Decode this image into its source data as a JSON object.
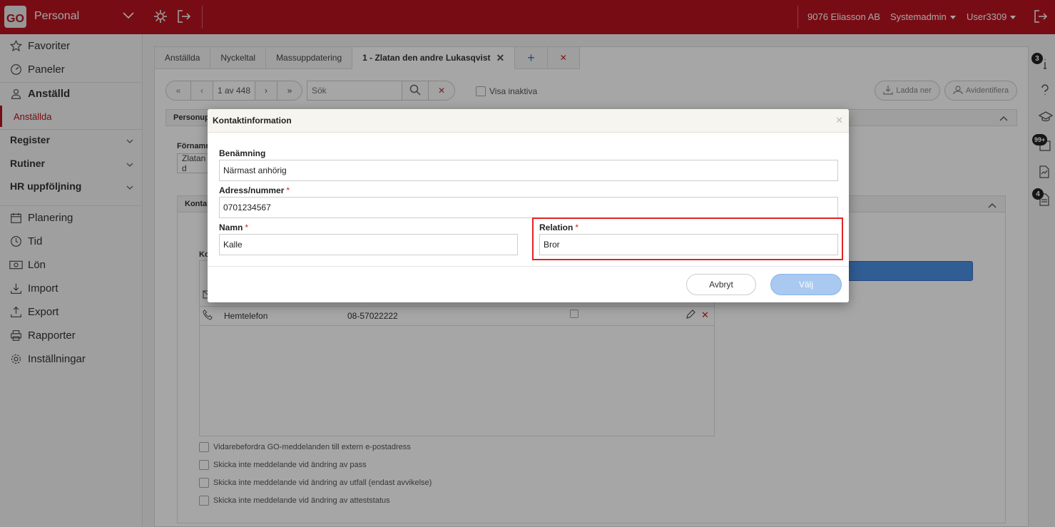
{
  "topbar": {
    "logo": "GO",
    "module": "Personal",
    "company": "9076 Eliasson AB",
    "role": "Systemadmin",
    "user": "User3309",
    "accent": "#b8131f"
  },
  "sidebar": {
    "favorites": "Favoriter",
    "panels": "Paneler",
    "employee": "Anställd",
    "employees_sub": "Anställda",
    "register": "Register",
    "routines": "Rutiner",
    "hr_followup": "HR uppföljning",
    "planning": "Planering",
    "time": "Tid",
    "salary": "Lön",
    "import": "Import",
    "export": "Export",
    "reports": "Rapporter",
    "settings": "Inställningar"
  },
  "tabs": [
    {
      "label": "Anställda"
    },
    {
      "label": "Nyckeltal"
    },
    {
      "label": "Massuppdatering"
    },
    {
      "label": "1 - Zlatan den andre Lukasqvist"
    }
  ],
  "toolbar": {
    "pager": "1 av 448",
    "search_placeholder": "Sök",
    "show_inactive": "Visa inaktiva",
    "download": "Ladda ner",
    "anonymize": "Avidentifiera"
  },
  "background": {
    "section_person": "Personupp",
    "first_name_label": "Förnamn",
    "first_name_value": "Zlatan d",
    "section_contact": "Kontakt",
    "contact_sub": "Ko",
    "row_type": "Hemtelefon",
    "row_value": "08-57022222",
    "checks": [
      "Vidarebefordra GO-meddelanden till extern e-postadress",
      "Skicka inte meddelande vid ändring av pass",
      "Skicka inte meddelande vid ändring av utfall (endast avvikelse)",
      "Skicka inte meddelande vid ändring av atteststatus"
    ]
  },
  "right_rail": {
    "badge_info": "3",
    "badge_tasks": "99+",
    "badge_docs": "4"
  },
  "modal": {
    "title": "Kontaktinformation",
    "name_label": "Benämning",
    "name_value": "Närmast anhörig",
    "address_label": "Adress/nummer",
    "address_value": "0701234567",
    "person_label": "Namn",
    "person_value": "Kalle",
    "relation_label": "Relation",
    "relation_value": "Bror",
    "required_mark": "*",
    "cancel": "Avbryt",
    "ok": "Välj"
  }
}
